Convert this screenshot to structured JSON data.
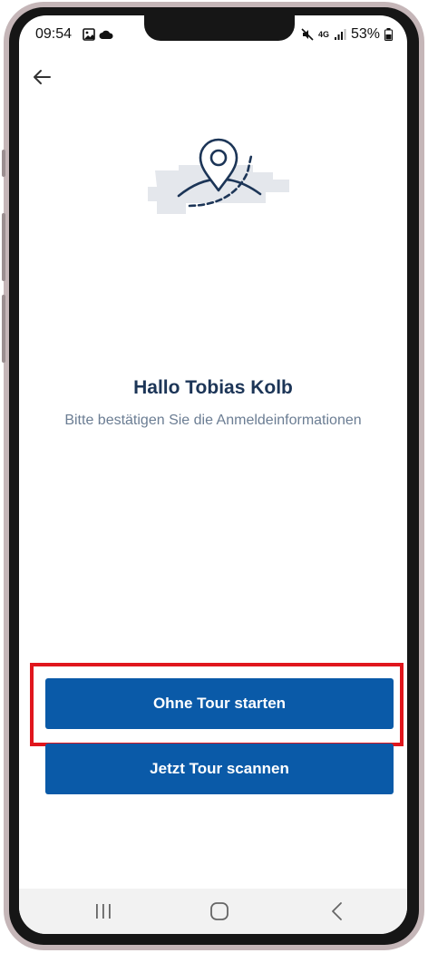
{
  "status_bar": {
    "time": "09:54",
    "battery_percent": "53%",
    "network": "4G",
    "left_icons": [
      "gallery-icon",
      "cloud-icon"
    ],
    "right_icons": [
      "mute-icon",
      "network-4g-icon",
      "signal-icon",
      "battery-icon"
    ]
  },
  "header": {
    "back_icon": "arrow-left-icon"
  },
  "illustration": {
    "icon": "location-pin-map-icon",
    "colors": {
      "stroke": "#1c3557",
      "background": "#e4e7ec"
    }
  },
  "content": {
    "greeting": "Hallo Tobias Kolb",
    "subtitle": "Bitte bestätigen Sie die Anmeldeinformationen"
  },
  "actions": {
    "start_without_tour_label": "Ohne Tour starten",
    "scan_tour_label": "Jetzt Tour scannen"
  },
  "nav_bar": {
    "items": [
      "recent-apps-icon",
      "home-icon",
      "back-icon"
    ]
  },
  "colors": {
    "primary_button": "#0a5aa8",
    "title_text": "#1c3557",
    "subtitle_text": "#6b7d93",
    "highlight": "#e0161d"
  }
}
